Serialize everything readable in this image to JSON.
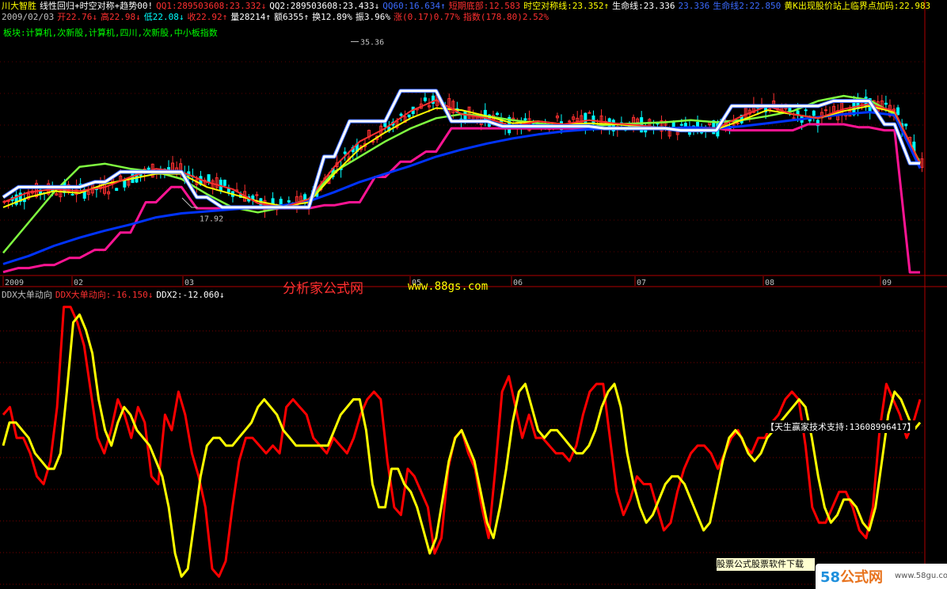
{
  "header": {
    "row1": [
      {
        "text": "川大智胜",
        "color": "#ffff00"
      },
      {
        "text": "线性回归+时空对称+趋势00!",
        "color": "#ffffff"
      },
      {
        "text": "QQ1:289503608:23.332↓",
        "color": "#ff3030"
      },
      {
        "text": "QQ2:289503608:23.433↓",
        "color": "#ffffff"
      },
      {
        "text": "QQ60:16.634↑",
        "color": "#3b6bff"
      },
      {
        "text": "短期底部:12.583",
        "color": "#ff3030"
      },
      {
        "text": "时空对称线:23.352↑",
        "color": "#ffff00"
      },
      {
        "text": "生命线:23.336",
        "color": "#ffffff"
      },
      {
        "text": "23.336",
        "color": "#3b6bff"
      },
      {
        "text": "生命线2:22.850",
        "color": "#3b6bff"
      },
      {
        "text": "黄K出现股价站上临界点加码:22.983",
        "color": "#ffff00"
      }
    ],
    "row2": [
      {
        "text": "2009/02/03",
        "color": "#c0c0c0"
      },
      {
        "text": "开22.76↓",
        "color": "#ff3030"
      },
      {
        "text": "高22.98↓",
        "color": "#ff3030"
      },
      {
        "text": "低22.08↓",
        "color": "#00ffff"
      },
      {
        "text": "收22.92↑",
        "color": "#ff3030"
      },
      {
        "text": "量28214↑",
        "color": "#ffffff"
      },
      {
        "text": "额6355↑",
        "color": "#ffffff"
      },
      {
        "text": "换12.89%",
        "color": "#ffffff"
      },
      {
        "text": "振3.96%",
        "color": "#ffffff"
      },
      {
        "text": "涨(0.17)0.77%",
        "color": "#ff3030"
      },
      {
        "text": "指数(178.80)2.52%",
        "color": "#ff3030"
      }
    ],
    "sector": "板块:计算机,次新股,计算机,四川,次新股,中小板指数"
  },
  "watermark": {
    "site_name": "分析家公式网",
    "site_url": "www.88gs.com"
  },
  "ddx_legend": [
    {
      "text": "DDX大单动向",
      "color": "#c0c0c0"
    },
    {
      "text": "DDX大单动向:-16.150↓",
      "color": "#ff3030"
    },
    {
      "text": "DDX2:-12.060↓",
      "color": "#ffffff"
    }
  ],
  "support_text": "【天生赢家技术支持:13608996417】",
  "download_text": "股票公式股票软件下载",
  "logo": {
    "num": "58",
    "word": "公式网",
    "url": "www.58gu.com"
  },
  "colors": {
    "up": "#ff3030",
    "down": "#00ffff",
    "ma_yellow": "#ffff00",
    "ma_green": "#80ff40",
    "ma_blue": "#0033ff",
    "bottom_magenta": "#ff1493",
    "ddx_red": "#ff0000",
    "ddx_yellow": "#ffff00"
  },
  "chart_data": [
    {
      "type": "line",
      "title": "",
      "x_labels": [
        "2009",
        "02",
        "03",
        "05",
        "06",
        "07",
        "08",
        "09"
      ],
      "ylim": [
        12.5,
        36.5
      ],
      "annotations": [
        {
          "text": "35.36",
          "value": 35.36
        },
        {
          "text": "17.92",
          "value": 17.92
        }
      ],
      "series": [
        {
          "name": "QQ1",
          "color": "#ff3030",
          "values": [
            19.5,
            20.5,
            20.8,
            20.6,
            21.0,
            22.0,
            22.8,
            22.5,
            21.5,
            20.8,
            19.4,
            19.0,
            19.8,
            23.0,
            25.5,
            26.8,
            28.5,
            29.6,
            28.2,
            27.8,
            27.0,
            27.5,
            27.2,
            27.6,
            27.3,
            27.1,
            26.8,
            26.7,
            26.8,
            28.0,
            29.0,
            28.2,
            27.8,
            28.7,
            29.2,
            28.5,
            23.3
          ]
        },
        {
          "name": "QQ2",
          "color": "#ffff00",
          "values": [
            19.0,
            20.0,
            20.6,
            20.4,
            21.3,
            21.8,
            22.3,
            22.3,
            21.0,
            20.3,
            19.6,
            19.1,
            19.5,
            22.3,
            24.8,
            26.4,
            27.8,
            28.8,
            28.6,
            28.0,
            27.3,
            27.5,
            27.2,
            27.3,
            27.2,
            27.0,
            26.8,
            26.7,
            26.7,
            27.6,
            28.6,
            28.2,
            27.8,
            28.5,
            29.0,
            28.4,
            23.4
          ]
        },
        {
          "name": "时空对称线",
          "color": "#ffffff",
          "values": [
            20.0,
            21.0,
            21.0,
            21.0,
            21.5,
            22.5,
            22.5,
            22.5,
            20.0,
            19.0,
            19.0,
            19.0,
            19.0,
            24.0,
            27.5,
            27.5,
            30.5,
            30.5,
            27.5,
            27.5,
            27.0,
            27.0,
            27.0,
            27.0,
            26.8,
            26.8,
            26.8,
            26.6,
            26.6,
            29.0,
            29.0,
            29.0,
            29.0,
            29.5,
            29.5,
            27.2,
            23.35
          ]
        },
        {
          "name": "生命线",
          "color": "#80ff40",
          "values": [
            14.5,
            17.5,
            20.5,
            23.0,
            23.3,
            22.8,
            22.5,
            21.8,
            20.3,
            19.0,
            18.5,
            19.0,
            19.8,
            22.5,
            24.0,
            25.5,
            26.8,
            27.8,
            28.2,
            28.0,
            27.6,
            27.3,
            27.0,
            27.0,
            27.2,
            27.3,
            27.4,
            27.6,
            27.4,
            27.6,
            28.0,
            28.5,
            29.5,
            30.0,
            29.6,
            28.2,
            23.3
          ]
        },
        {
          "name": "生命线2",
          "color": "#0033ff",
          "values": [
            13.4,
            14.2,
            15.2,
            16.0,
            16.7,
            17.3,
            18.0,
            18.4,
            18.6,
            18.8,
            19.0,
            19.2,
            19.6,
            20.5,
            21.5,
            22.3,
            23.1,
            24.0,
            24.7,
            25.3,
            25.8,
            26.2,
            26.5,
            26.7,
            26.8,
            26.8,
            26.8,
            26.9,
            26.8,
            27.0,
            27.3,
            27.6,
            27.9,
            28.2,
            28.4,
            28.1,
            22.85
          ]
        },
        {
          "name": "短期底部",
          "color": "#ff1493",
          "values": [
            12.6,
            13.0,
            13.3,
            14.0,
            14.8,
            16.5,
            19.5,
            21.0,
            18.9,
            18.9,
            18.9,
            18.9,
            18.9,
            19.2,
            19.5,
            22.0,
            23.5,
            24.5,
            26.8,
            26.8,
            26.8,
            26.8,
            26.8,
            26.8,
            26.8,
            26.8,
            26.8,
            26.8,
            26.8,
            26.6,
            26.6,
            26.6,
            27.2,
            27.2,
            26.9,
            26.6,
            12.58
          ]
        }
      ]
    },
    {
      "type": "line",
      "title": "DDX大单动向",
      "ylim": [
        -20,
        17
      ],
      "series": [
        {
          "name": "DDX大单动向",
          "color": "#ff0000",
          "values": [
            2,
            3,
            -1,
            -1,
            -3,
            -6,
            -7,
            -4,
            3,
            16,
            16,
            14,
            11,
            5,
            -1,
            -3,
            0,
            4,
            2,
            -1,
            3,
            1,
            -6,
            -7,
            2,
            0,
            5,
            2,
            -3,
            -6,
            -10,
            -18,
            -19,
            -17,
            -10,
            -4,
            -1,
            -1,
            -2,
            -3,
            -2,
            -3,
            3,
            4,
            3,
            2,
            -1,
            -2,
            -3,
            -1,
            -2,
            -3,
            -1,
            2,
            4,
            5,
            4,
            -4,
            -10,
            -11,
            -5,
            -6,
            -8,
            -10,
            -16,
            -14,
            -5,
            -1,
            0,
            -3,
            -5,
            -10,
            -14,
            -5,
            5,
            7,
            3,
            -1,
            2,
            -1,
            -1,
            -2,
            -3,
            -3,
            -4,
            -2,
            2,
            5,
            6,
            6,
            -1,
            -8,
            -11,
            -9,
            -6,
            -7,
            -7,
            -10,
            -13,
            -12,
            -8,
            -5,
            -3,
            -2,
            -2,
            -3,
            -5,
            -3,
            -1,
            0,
            -2,
            -3,
            -1,
            -1,
            1,
            2,
            4,
            5,
            4,
            -2,
            -10,
            -12,
            -12,
            -10,
            -8,
            -8,
            -10,
            -13,
            -14,
            -10,
            0,
            6,
            4,
            2,
            -1,
            1,
            4
          ]
        },
        {
          "name": "DDX2",
          "color": "#ffff00",
          "values": [
            -2,
            1,
            1,
            0,
            -1,
            -3,
            -4,
            -5,
            -5,
            -3,
            5,
            14,
            15,
            13,
            10,
            4,
            0,
            -2,
            1,
            3,
            2,
            0,
            -1,
            -2,
            -4,
            -6,
            -10,
            -16,
            -19,
            -18,
            -12,
            -6,
            -2,
            -1,
            -1,
            -2,
            -2,
            -1,
            0,
            1,
            3,
            4,
            3,
            2,
            0,
            -1,
            -2,
            -2,
            -2,
            -2,
            -2,
            -2,
            0,
            2,
            3,
            4,
            4,
            0,
            -7,
            -10,
            -10,
            -5,
            -5,
            -7,
            -8,
            -10,
            -13,
            -16,
            -14,
            -9,
            -4,
            -1,
            0,
            -2,
            -4,
            -8,
            -12,
            -14,
            -10,
            -5,
            1,
            5,
            6,
            3,
            0,
            -1,
            0,
            0,
            -1,
            -2,
            -3,
            -3,
            -2,
            0,
            3,
            5,
            6,
            3,
            -3,
            -7,
            -10,
            -12,
            -11,
            -9,
            -7,
            -6,
            -6,
            -7,
            -9,
            -11,
            -13,
            -12,
            -8,
            -4,
            -1,
            0,
            -1,
            -3,
            -4,
            -3,
            -1,
            0,
            1,
            2,
            3,
            4,
            3,
            -1,
            -6,
            -10,
            -12,
            -11,
            -9,
            -9,
            -10,
            -12,
            -13,
            -10,
            -4,
            2,
            5,
            4,
            2,
            0,
            1
          ]
        }
      ]
    }
  ]
}
